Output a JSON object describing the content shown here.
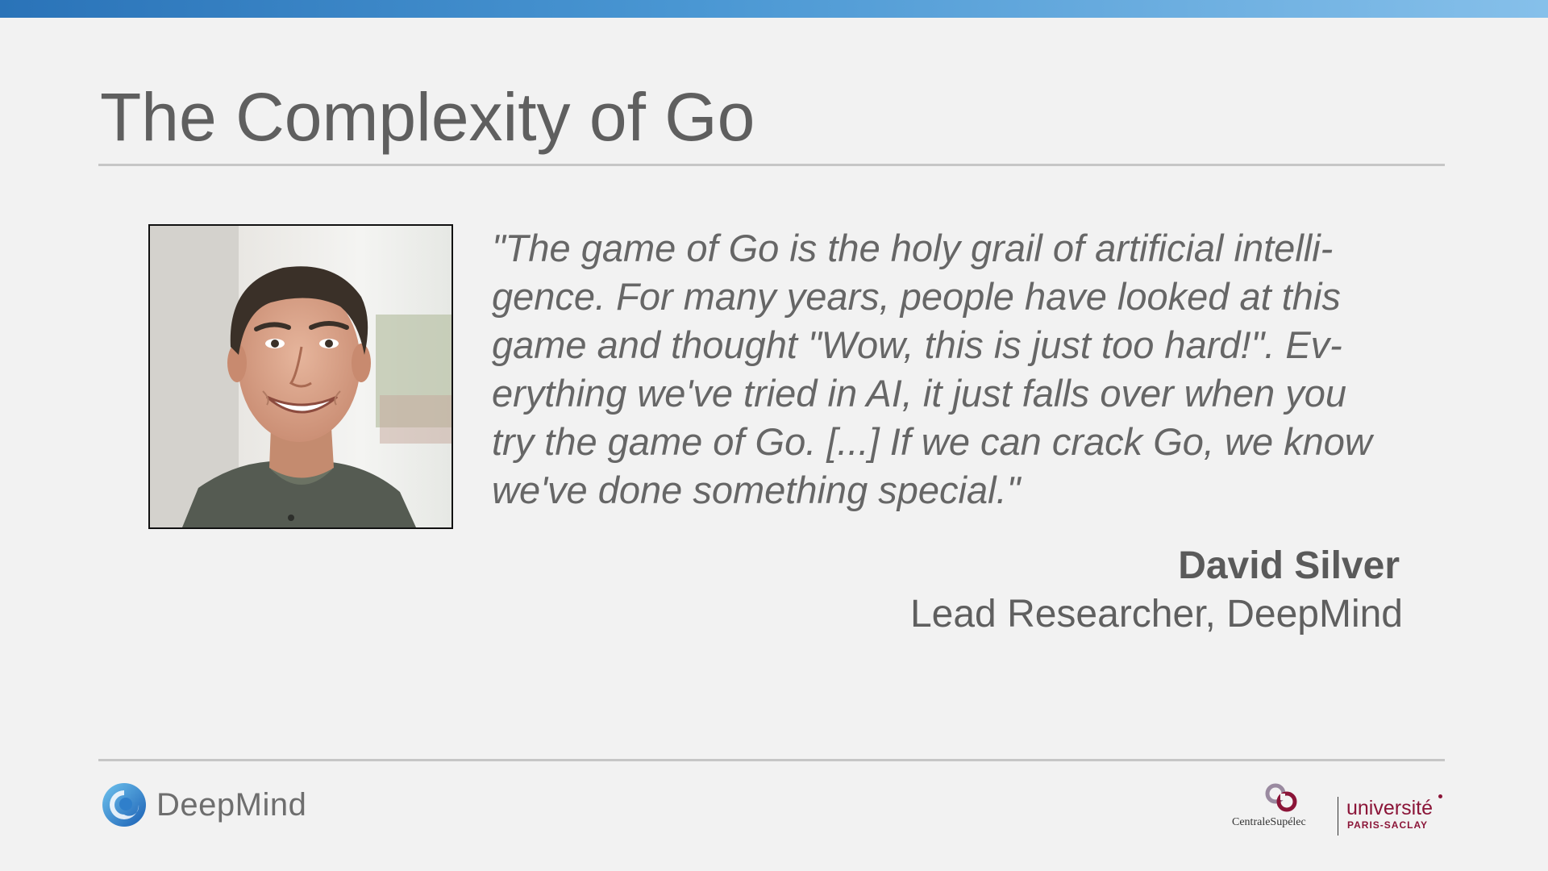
{
  "slide": {
    "title": "The Complexity of Go",
    "quote_lines": [
      "\"The game of Go is the holy grail of artificial intelli-",
      "gence. For many years, people have looked at this",
      "game and thought \"Wow, this is just too hard!\". Ev-",
      "erything we've tried in AI, it just falls over when you",
      "try the game of Go. [...] If we can crack Go, we know",
      "we've done something special.\""
    ],
    "author": {
      "name": "David Silver",
      "role": "Lead Researcher, DeepMind"
    }
  },
  "footer": {
    "left_logo_text": "DeepMind",
    "right_logo": {
      "centrale_text": "CentraleSupélec",
      "universite_text": "université",
      "paris_saclay_text": "PARIS-SACLAY"
    }
  },
  "colors": {
    "top_bar_start": "#2a73b8",
    "top_bar_end": "#86c0ea",
    "background": "#f2f2f2",
    "text": "#606060",
    "rule": "#c6c6c6",
    "universite": "#8b1538"
  },
  "icons": {
    "portrait": "person-photo",
    "deepmind": "deepmind-logo-icon",
    "centrale": "centralesupelec-logo-icon"
  }
}
